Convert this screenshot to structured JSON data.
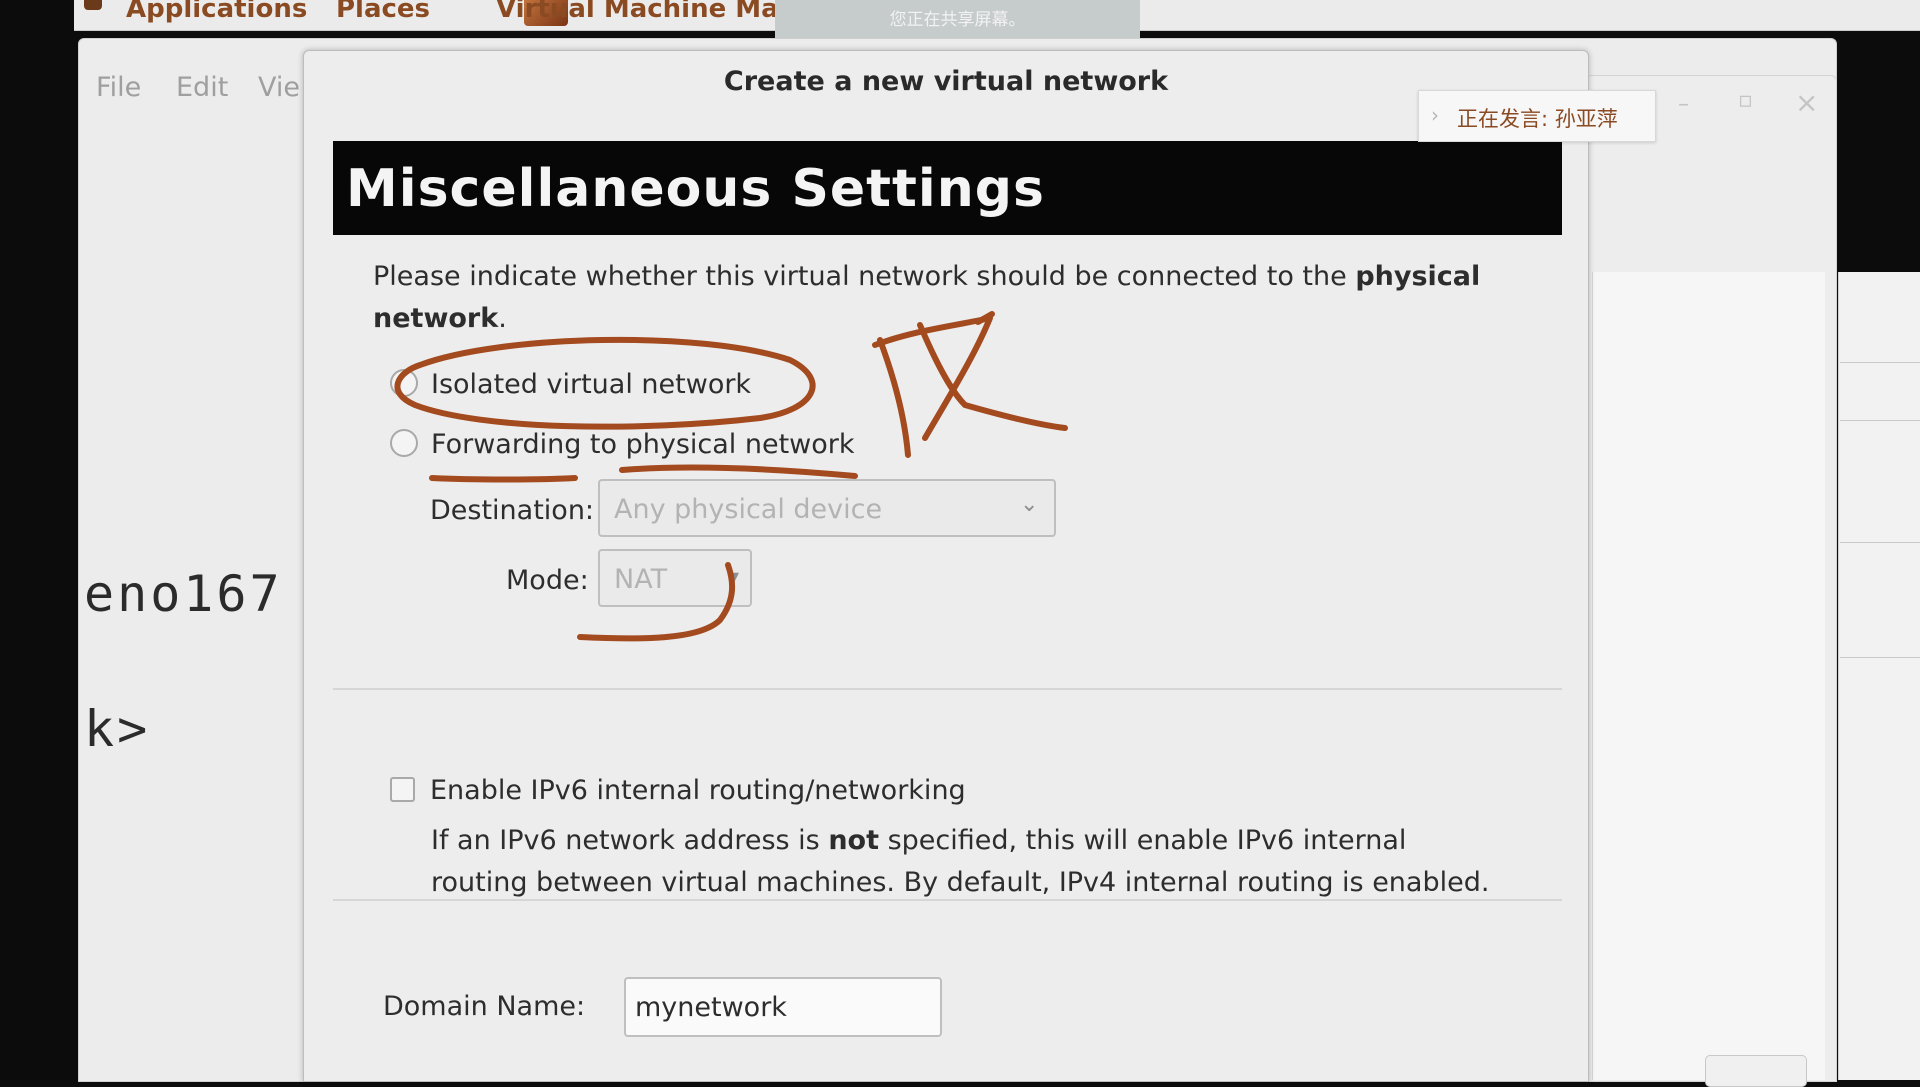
{
  "top_panel": {
    "applications_label": "Applications",
    "places_label": "Places",
    "vmm_label": "Virtual Machine Ma"
  },
  "share_banner": {
    "text": "您正在共享屏幕。"
  },
  "background_window": {
    "menu": {
      "file": "File",
      "edit": "Edit",
      "view": "Vie"
    },
    "terminal_line_1": "eno167",
    "terminal_line_2": "k>"
  },
  "right_window_buttons": {
    "minimize": "–",
    "maximize": "▫",
    "close": "×"
  },
  "speaker_badge": {
    "label": "正在发言:  孙亚萍"
  },
  "dialog": {
    "title": "Create a new virtual network",
    "header": "Miscellaneous Settings",
    "description_prefix": "Please indicate whether this virtual network should be connected to the ",
    "description_bold": "physical network",
    "description_suffix": ".",
    "radio_isolated": "Isolated virtual network",
    "radio_forwarding": "Forwarding to physical network",
    "destination_label": "Destination:",
    "destination_value": "Any physical device",
    "mode_label": "Mode:",
    "mode_value": "NAT",
    "ipv6_label": "Enable IPv6 internal routing/networking",
    "ipv6_help_prefix": "If an IPv6 network address is ",
    "ipv6_help_bold": "not",
    "ipv6_help_suffix": " specified, this will enable IPv6 internal routing between virtual machines.  By default, IPv4 internal routing is enabled.",
    "domain_label": "Domain Name:",
    "domain_value": "mynetwork"
  },
  "colors": {
    "annotation": "#a34a1f",
    "header_bg": "#070707"
  }
}
